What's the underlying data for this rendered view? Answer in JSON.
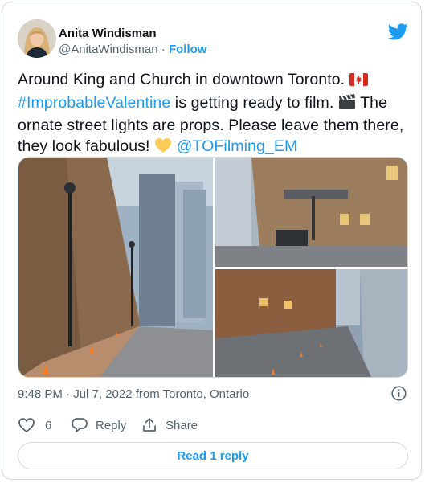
{
  "author": {
    "name": "Anita Windisman",
    "handle": "@AnitaWindisman",
    "separator": " · ",
    "follow_label": "Follow"
  },
  "tweet": {
    "text_1": "Around King and Church in downtown Toronto. ",
    "hashtag": "#ImprobableValentine",
    "text_2": " is getting ready to film. ",
    "text_3": " The ornate street lights are props. Please leave them there, they look fabulous! ",
    "mention": "@TOFilming_EM",
    "emojis": [
      "canada-flag",
      "clapper-board",
      "yellow-heart"
    ]
  },
  "meta": {
    "timestamp": "9:48 PM · Jul 7, 2022 from Toronto, Ontario"
  },
  "actions": {
    "like_count": "6",
    "reply_label": "Reply",
    "share_label": "Share"
  },
  "read_reply_label": "Read 1 reply",
  "colors": {
    "accent": "#1d9bf0",
    "text": "#0f1419",
    "secondary": "#536471",
    "border": "#cfd9de",
    "heart": "#fdcb58"
  },
  "icons": [
    "twitter-bird-icon",
    "info-icon",
    "heart-icon",
    "reply-icon",
    "share-icon"
  ]
}
